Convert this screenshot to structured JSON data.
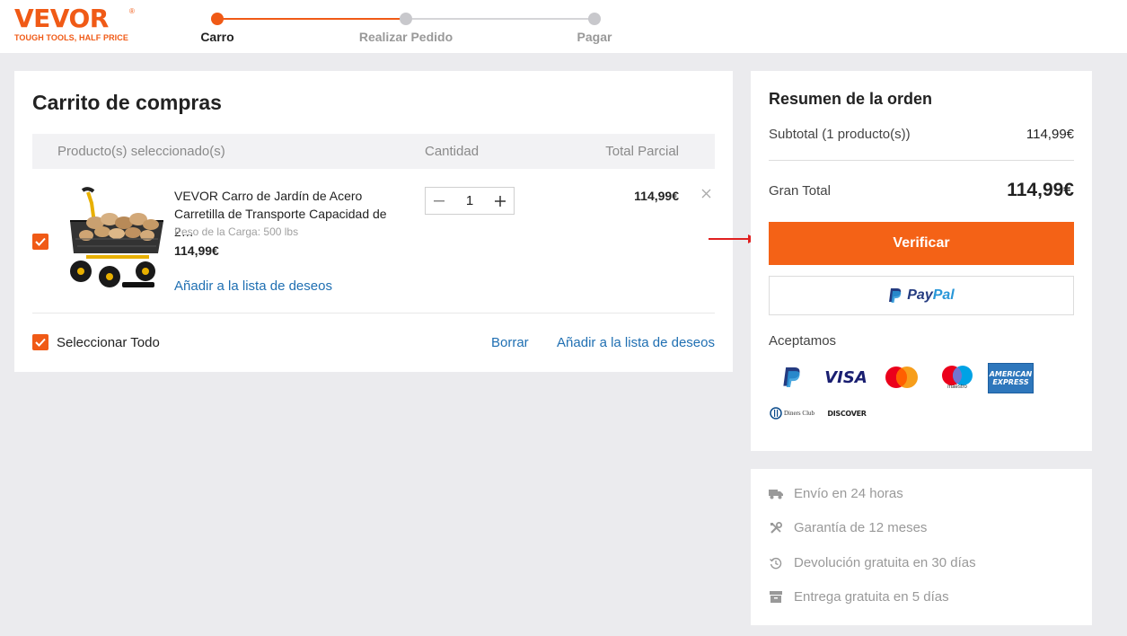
{
  "brand": {
    "name": "VEVOR",
    "registered": "®",
    "tagline": "TOUGH TOOLS, HALF PRICE",
    "color": "#f05a16"
  },
  "steps": [
    {
      "label": "Carro",
      "active": true
    },
    {
      "label": "Realizar Pedido",
      "active": false
    },
    {
      "label": "Pagar",
      "active": false
    }
  ],
  "cart": {
    "title": "Carrito de compras",
    "columns": {
      "product": "Producto(s) seleccionado(s)",
      "quantity": "Cantidad",
      "subtotal": "Total Parcial"
    },
    "items": [
      {
        "checked": true,
        "name": "VEVOR Carro de Jardín de Acero Carretilla de Transporte Capacidad de 2…",
        "attribute": "Peso de la Carga: 500 lbs",
        "price": "114,99€",
        "quantity": "1",
        "line_total": "114,99€",
        "wishlist_label": "Añadir a la lista de deseos",
        "image_icon": "garden-cart-product-image"
      }
    ],
    "select_all_label": "Seleccionar Todo",
    "delete_label": "Borrar",
    "wishlist_all_label": "Añadir a la lista de deseos"
  },
  "summary": {
    "title": "Resumen de la orden",
    "subtotal_label": "Subtotal (1 producto(s))",
    "subtotal_value": "114,99€",
    "grand_total_label": "Gran Total",
    "grand_total_value": "114,99€",
    "verify_label": "Verificar",
    "paypal_pay": "Pay",
    "paypal_pal": "Pal",
    "accept_label": "Aceptamos",
    "payment_methods": [
      "paypal-icon",
      "visa-icon",
      "mastercard-icon",
      "maestro-icon",
      "amex-icon",
      "diners-club-icon",
      "discover-icon"
    ],
    "visa_text": "VISA",
    "maestro_text": "maestro",
    "amex_text_1": "AMERICAN",
    "amex_text_2": "EXPRESS",
    "diners_text": "Diners Club",
    "discover_text": "DISCOVER",
    "accent_color": "#f46216"
  },
  "benefits": [
    {
      "icon": "truck-icon",
      "label": "Envío en 24 horas"
    },
    {
      "icon": "tools-icon",
      "label": "Garantía de 12 meses"
    },
    {
      "icon": "history-icon",
      "label": "Devolución gratuita en 30 días"
    },
    {
      "icon": "box-icon",
      "label": "Entrega gratuita en 5 días"
    }
  ],
  "annotation_color": "#e02020"
}
